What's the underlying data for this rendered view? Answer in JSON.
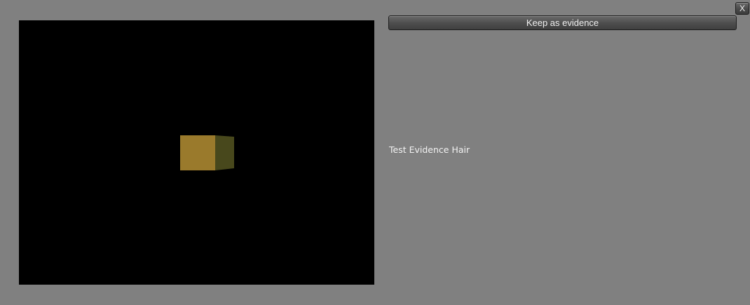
{
  "window": {
    "close_label": "X"
  },
  "viewer": {
    "background_color": "#000000",
    "model": {
      "front_color": "#9a7a2c",
      "side_color": "#48481c"
    }
  },
  "actions": {
    "keep_label": "Keep as evidence"
  },
  "evidence": {
    "name": "Test Evidence Hair"
  }
}
